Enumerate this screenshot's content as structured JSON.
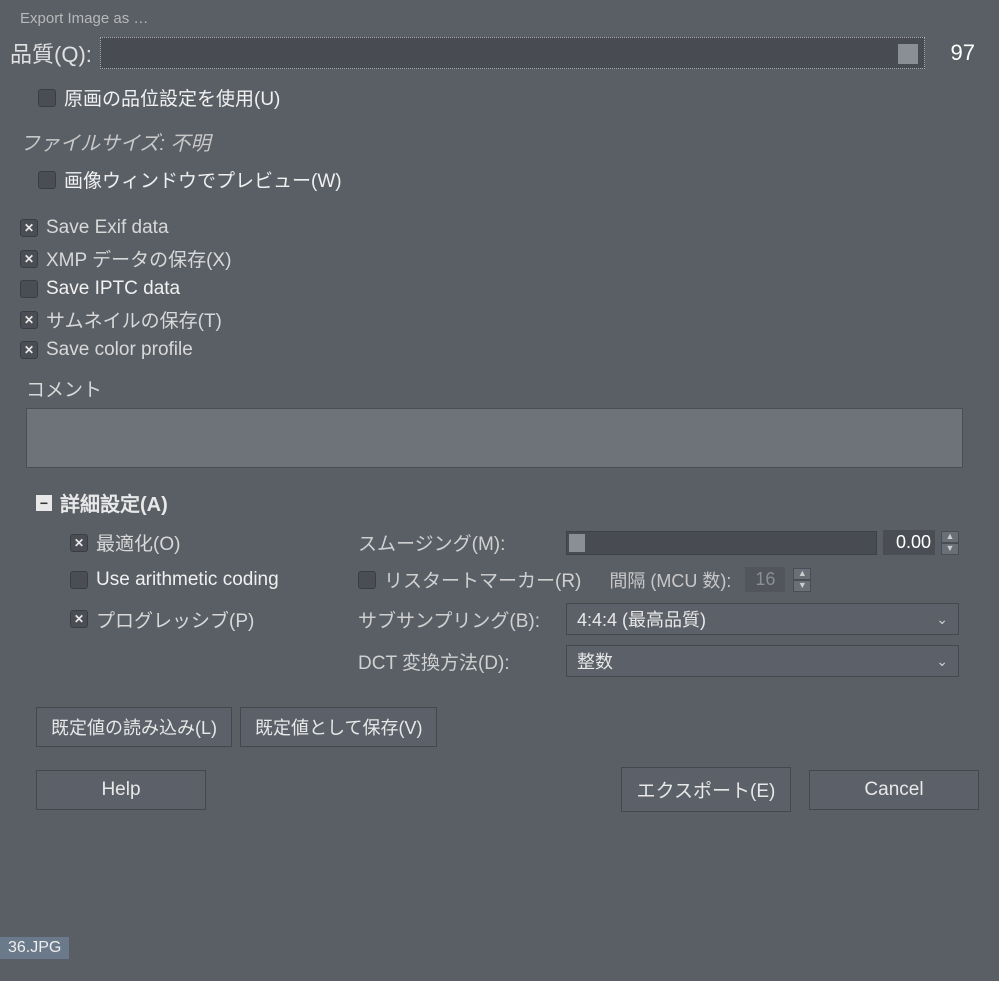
{
  "title_hint": "Export Image as …",
  "quality": {
    "label": "品質(Q):",
    "value": "97"
  },
  "use_original_quality": {
    "label": "原画の品位設定を使用(U)",
    "checked": false
  },
  "filesize": "ファイルサイズ: 不明",
  "preview": {
    "label": "画像ウィンドウでプレビュー(W)",
    "checked": false
  },
  "save_exif": {
    "label": "Save Exif data",
    "checked": true
  },
  "save_xmp": {
    "label": "XMP データの保存(X)",
    "checked": true
  },
  "save_iptc": {
    "label": "Save IPTC data",
    "checked": false
  },
  "save_thumb": {
    "label": "サムネイルの保存(T)",
    "checked": true
  },
  "save_color_profile": {
    "label": "Save color profile",
    "checked": true
  },
  "comment_label": "コメント",
  "advanced_label": "詳細設定(A)",
  "optimize": {
    "label": "最適化(O)",
    "checked": true
  },
  "smoothing": {
    "label": "スムージング(M):",
    "value": "0.00"
  },
  "arithmetic": {
    "label": "Use arithmetic coding",
    "checked": false
  },
  "restart": {
    "label": "リスタートマーカー(R)",
    "checked": false
  },
  "interval": {
    "label": "間隔 (MCU 数):",
    "value": "16"
  },
  "progressive": {
    "label": "プログレッシブ(P)",
    "checked": true
  },
  "subsampling": {
    "label": "サブサンプリング(B):",
    "value": "4:4:4 (最高品質)"
  },
  "dct": {
    "label": "DCT 変換方法(D):",
    "value": "整数"
  },
  "load_defaults": "既定値の読み込み(L)",
  "save_defaults": "既定値として保存(V)",
  "help": "Help",
  "export": "エクスポート(E)",
  "cancel": "Cancel",
  "bg_thumb": "36.JPG"
}
